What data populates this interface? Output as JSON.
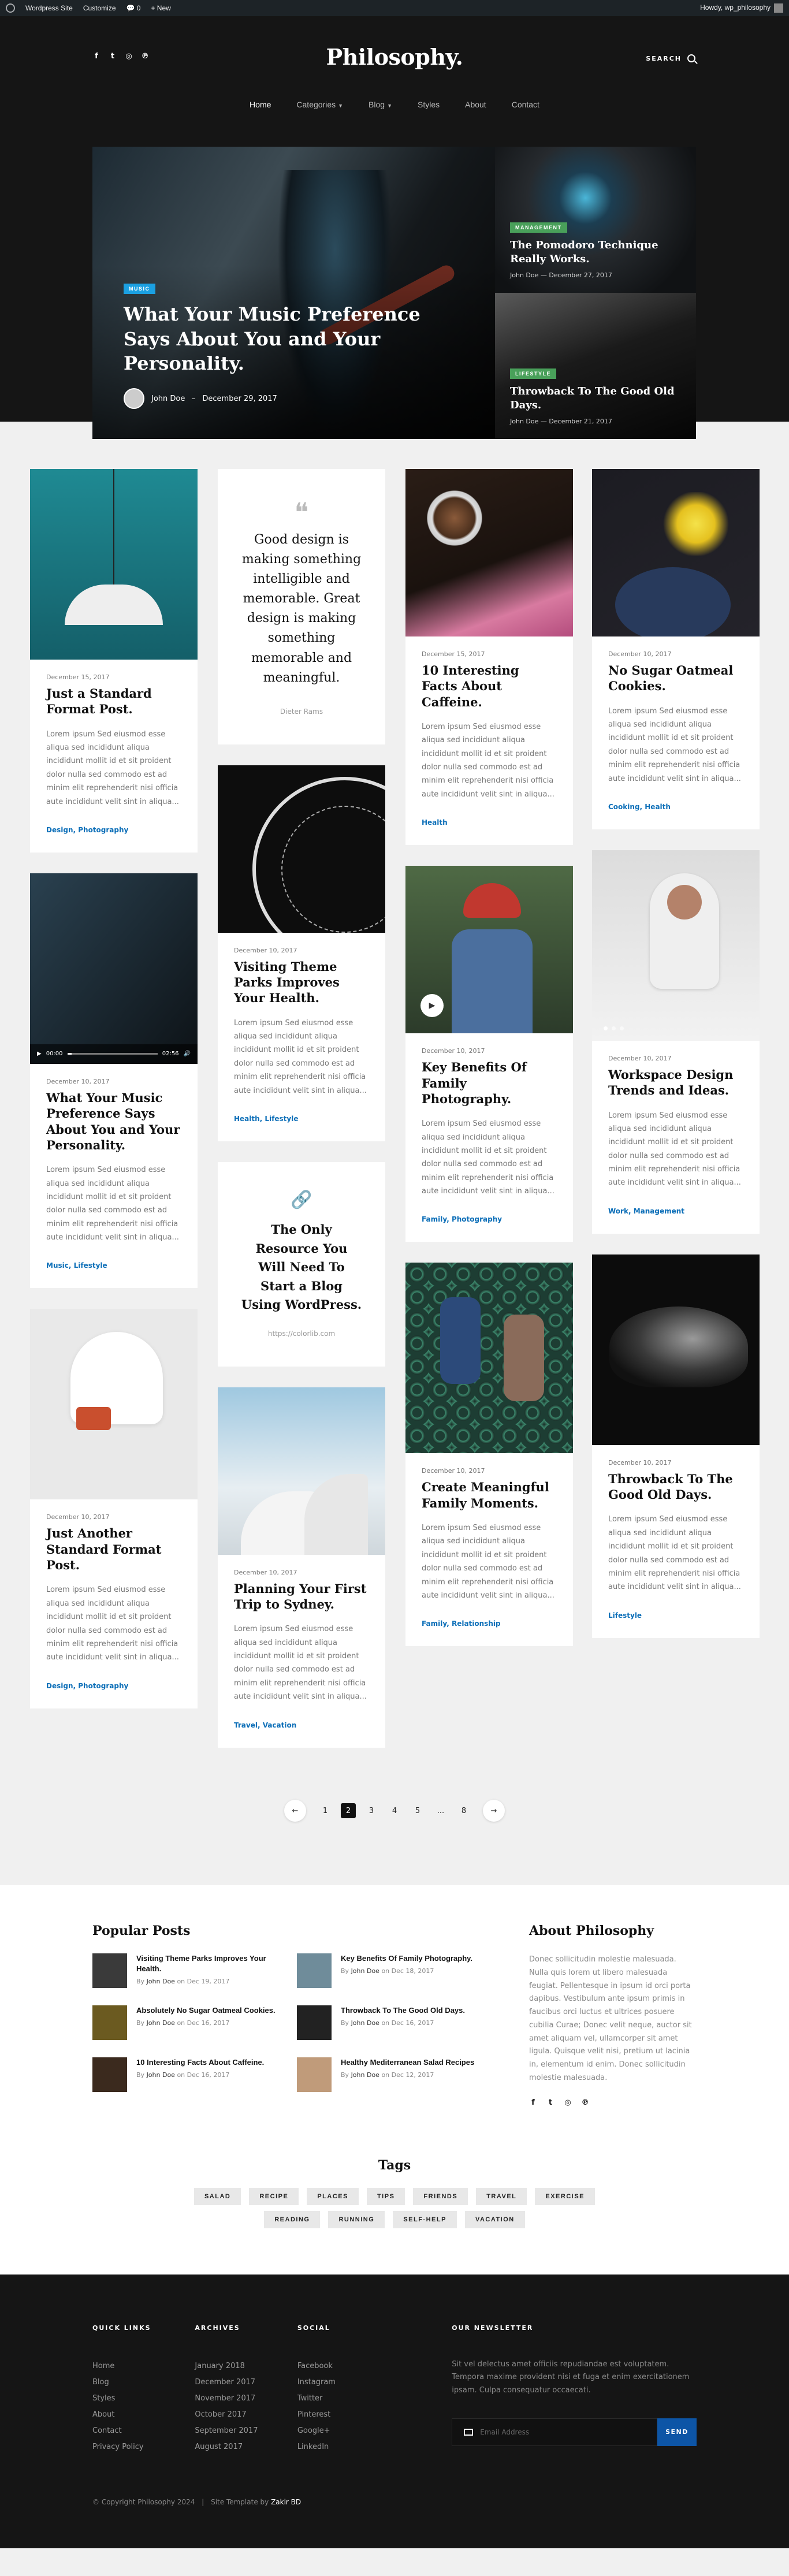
{
  "adminbar": {
    "site": "Wordpress Site",
    "customize": "Customize",
    "comments": "0",
    "new": "+  New",
    "howdy": "Howdy, wp_philosophy"
  },
  "header": {
    "logo": "Philosophy.",
    "search_label": "SEARCH",
    "nav": [
      {
        "label": "Home"
      },
      {
        "label": "Categories"
      },
      {
        "label": "Blog"
      },
      {
        "label": "Styles"
      },
      {
        "label": "About"
      },
      {
        "label": "Contact"
      }
    ]
  },
  "hero": {
    "main": {
      "category": "MUSIC",
      "title": "What Your Music Preference Says About You and Your Personality.",
      "author": "John Doe",
      "date": "December 29, 2017"
    },
    "side": [
      {
        "category": "MANAGEMENT",
        "title": "The Pomodoro Technique Really Works.",
        "author": "John Doe",
        "date": "December 27, 2017"
      },
      {
        "category": "LIFESTYLE",
        "title": "Throwback To The Good Old Days.",
        "author": "John Doe",
        "date": "December 21, 2017"
      }
    ]
  },
  "excerpt": "Lorem ipsum Sed eiusmod esse aliqua sed incididunt aliqua incididunt mollit id et sit proident dolor nulla sed commodo est ad minim elit reprehenderit nisi officia aute incididunt velit sint in aliqua...",
  "cards": {
    "c1": {
      "date": "December 15, 2017",
      "title": "Just a Standard Format Post.",
      "cats": "Design, Photography"
    },
    "c2": {
      "date": "December 10, 2017",
      "title": "What Your Music Preference Says About You and Your Personality.",
      "cats": "Music, Lifestyle",
      "time1": "00:00",
      "time2": "02:56"
    },
    "c3": {
      "date": "December 10, 2017",
      "title": "Just Another Standard Format Post.",
      "cats": "Design, Photography"
    },
    "q1": {
      "text": "Good design is making something intelligible and memorable. Great design is making something memorable and meaningful.",
      "author": "Dieter Rams"
    },
    "c4": {
      "date": "December 10, 2017",
      "title": "Visiting Theme Parks Improves Your Health.",
      "cats": "Health, Lifestyle"
    },
    "l1": {
      "title": "The Only Resource You Will Need To Start a Blog Using WordPress.",
      "url": "https://colorlib.com"
    },
    "c5": {
      "date": "December 10, 2017",
      "title": "Planning Your First Trip to Sydney.",
      "cats": "Travel, Vacation"
    },
    "c6": {
      "date": "December 15, 2017",
      "title": "10 Interesting Facts About Caffeine.",
      "cats": "Health"
    },
    "c7": {
      "date": "December 10, 2017",
      "title": "Key Benefits Of Family Photography.",
      "cats": "Family, Photography"
    },
    "c8": {
      "date": "December 10, 2017",
      "title": "Create Meaningful Family Moments.",
      "cats": "Family, Relationship"
    },
    "c9": {
      "date": "December 10, 2017",
      "title": "No Sugar Oatmeal Cookies.",
      "cats": "Cooking, Health"
    },
    "c10": {
      "date": "December 10, 2017",
      "title": "Workspace Design Trends and Ideas.",
      "cats": "Work, Management"
    },
    "c11": {
      "date": "December 10, 2017",
      "title": "Throwback To The Good Old Days.",
      "cats": "Lifestyle"
    }
  },
  "pagination": {
    "pages": [
      "1",
      "2",
      "3",
      "4",
      "5",
      "...",
      "8"
    ],
    "current": "2"
  },
  "popular": {
    "title": "Popular Posts",
    "by": "By",
    "on": "on",
    "items": [
      {
        "title": "Visiting Theme Parks Improves Your Health.",
        "author": "John Doe",
        "date": "Dec 19, 2017",
        "color": "#3a3a3a"
      },
      {
        "title": "Key Benefits Of Family Photography.",
        "author": "John Doe",
        "date": "Dec 18, 2017",
        "color": "#6f8c9a"
      },
      {
        "title": "Absolutely No Sugar Oatmeal Cookies.",
        "author": "John Doe",
        "date": "Dec 16, 2017",
        "color": "#6b5a20"
      },
      {
        "title": "Throwback To The Good Old Days.",
        "author": "John Doe",
        "date": "Dec 16, 2017",
        "color": "#222222"
      },
      {
        "title": "10 Interesting Facts About Caffeine.",
        "author": "John Doe",
        "date": "Dec 16, 2017",
        "color": "#3b2a1e"
      },
      {
        "title": "Healthy Mediterranean Salad Recipes",
        "author": "John Doe",
        "date": "Dec 12, 2017",
        "color": "#c09b7a"
      }
    ]
  },
  "about": {
    "title": "About Philosophy",
    "text": "Donec sollicitudin molestie malesuada. Nulla quis lorem ut libero malesuada feugiat. Pellentesque in ipsum id orci porta dapibus. Vestibulum ante ipsum primis in faucibus orci luctus et ultrices posuere cubilia Curae; Donec velit neque, auctor sit amet aliquam vel, ullamcorper sit amet ligula. Quisque velit nisi, pretium ut lacinia in, elementum id enim. Donec sollicitudin molestie malesuada."
  },
  "tags": {
    "title": "Tags",
    "items": [
      "SALAD",
      "RECIPE",
      "PLACES",
      "TIPS",
      "FRIENDS",
      "TRAVEL",
      "EXERCISE",
      "READING",
      "RUNNING",
      "SELF-HELP",
      "VACATION"
    ]
  },
  "footer": {
    "quick": {
      "title": "QUICK LINKS",
      "items": [
        "Home",
        "Blog",
        "Styles",
        "About",
        "Contact",
        "Privacy Policy"
      ]
    },
    "archives": {
      "title": "ARCHIVES",
      "items": [
        "January 2018",
        "December 2017",
        "November 2017",
        "October 2017",
        "September 2017",
        "August 2017"
      ]
    },
    "social": {
      "title": "SOCIAL",
      "items": [
        "Facebook",
        "Instagram",
        "Twitter",
        "Pinterest",
        "Google+",
        "LinkedIn"
      ]
    },
    "newsletter": {
      "title": "OUR NEWSLETTER",
      "text": "Sit vel delectus amet officiis repudiandae est voluptatem. Tempora maxime provident nisi et fuga et enim exercitationem ipsam. Culpa consequatur occaecati.",
      "placeholder": "Email Address",
      "button": "SEND"
    },
    "copyright": "© Copyright Philosophy 2024",
    "template_by": "Site Template by",
    "template_author": "Zakir BD"
  }
}
